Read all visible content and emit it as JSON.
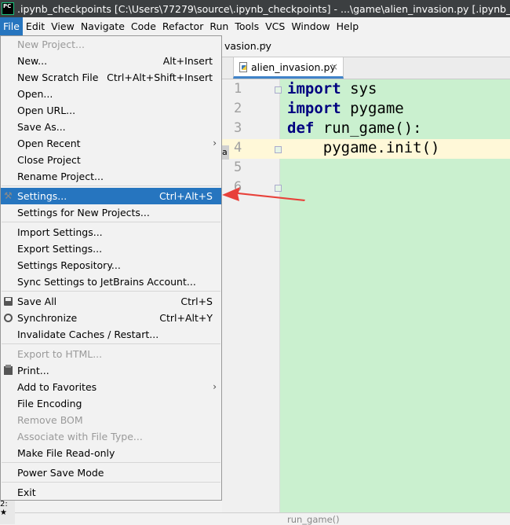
{
  "window": {
    "title": ".ipynb_checkpoints [C:\\Users\\77279\\source\\.ipynb_checkpoints] - ...\\game\\alien_invasion.py [.ipynb_checkpoi"
  },
  "menubar": {
    "items": [
      "File",
      "Edit",
      "View",
      "Navigate",
      "Code",
      "Refactor",
      "Run",
      "Tools",
      "VCS",
      "Window",
      "Help"
    ]
  },
  "file_menu": {
    "items": [
      {
        "label": "New Project...",
        "shortcut": ""
      },
      {
        "label": "New...",
        "shortcut": "Alt+Insert"
      },
      {
        "label": "New Scratch File",
        "shortcut": "Ctrl+Alt+Shift+Insert"
      },
      {
        "label": "Open...",
        "shortcut": ""
      },
      {
        "label": "Open URL...",
        "shortcut": ""
      },
      {
        "label": "Save As...",
        "shortcut": ""
      },
      {
        "label": "Open Recent",
        "shortcut": ""
      },
      {
        "label": "Close Project",
        "shortcut": ""
      },
      {
        "label": "Rename Project...",
        "shortcut": ""
      },
      {
        "label": "Settings...",
        "shortcut": "Ctrl+Alt+S"
      },
      {
        "label": "Settings for New Projects...",
        "shortcut": ""
      },
      {
        "label": "Import Settings...",
        "shortcut": ""
      },
      {
        "label": "Export Settings...",
        "shortcut": ""
      },
      {
        "label": "Settings Repository...",
        "shortcut": ""
      },
      {
        "label": "Sync Settings to JetBrains Account...",
        "shortcut": ""
      },
      {
        "label": "Save All",
        "shortcut": "Ctrl+S"
      },
      {
        "label": "Synchronize",
        "shortcut": "Ctrl+Alt+Y"
      },
      {
        "label": "Invalidate Caches / Restart...",
        "shortcut": ""
      },
      {
        "label": "Export to HTML...",
        "shortcut": ""
      },
      {
        "label": "Print...",
        "shortcut": ""
      },
      {
        "label": "Add to Favorites",
        "shortcut": ""
      },
      {
        "label": "File Encoding",
        "shortcut": ""
      },
      {
        "label": "Remove BOM",
        "shortcut": ""
      },
      {
        "label": "Associate with File Type...",
        "shortcut": ""
      },
      {
        "label": "Make File Read-only",
        "shortcut": ""
      },
      {
        "label": "Power Save Mode",
        "shortcut": ""
      },
      {
        "label": "Exit",
        "shortcut": ""
      }
    ],
    "submenu_arrow": "›"
  },
  "editor": {
    "breadcrumb": "vasion.py",
    "breadcrumb_chevron": "›",
    "tab_label": "alien_invasion.py",
    "tab_close": "×",
    "line_numbers": [
      "1",
      "2",
      "3",
      "4",
      "5",
      "6"
    ],
    "code": {
      "l1_kw": "import",
      "l1_rest": " sys",
      "l2_kw": "import",
      "l2_rest": " pygame",
      "l3_kw": "def",
      "l3_rest": " run_game():",
      "l4": "    pygame.init()"
    },
    "side_marker": "a"
  },
  "statusbar": {
    "text": "run_game()"
  },
  "left_strip": {
    "glyph1": "2:",
    "glyph2": "★"
  },
  "colors": {
    "highlight": "#2675bf",
    "code_background": "#caf0cf",
    "current_line": "#fff8d8",
    "annotation_arrow": "#e8413a"
  }
}
